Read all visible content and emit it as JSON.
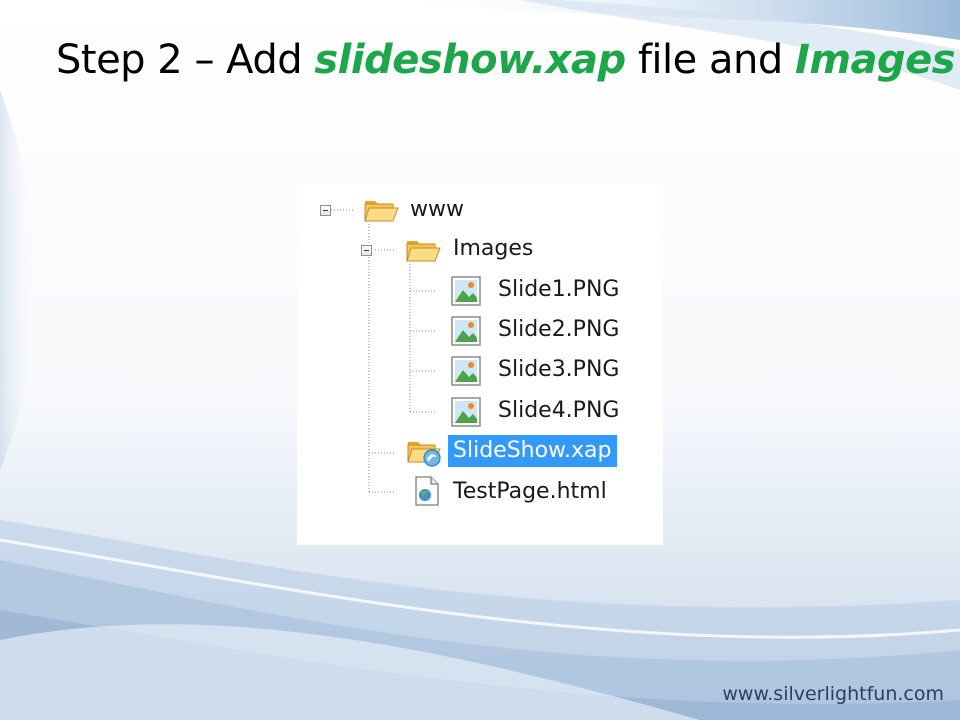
{
  "slide": {
    "title_part1": "Step 2 – Add ",
    "title_highlight1": "slideshow.xap",
    "title_part2": " file and ",
    "title_highlight2": "Images",
    "footer_url": "www.silverlightfun.com"
  },
  "tree": {
    "root": {
      "label": "www",
      "icon": "open-folder-icon",
      "expanded": true
    },
    "images_folder": {
      "label": "Images",
      "icon": "open-folder-icon",
      "expanded": true
    },
    "files": [
      {
        "label": "Slide1.PNG",
        "icon": "image-file-icon"
      },
      {
        "label": "Slide2.PNG",
        "icon": "image-file-icon"
      },
      {
        "label": "Slide3.PNG",
        "icon": "image-file-icon"
      },
      {
        "label": "Slide4.PNG",
        "icon": "image-file-icon"
      }
    ],
    "xap": {
      "label": "SlideShow.xap",
      "icon": "silverlight-package-icon",
      "selected": true
    },
    "html": {
      "label": "TestPage.html",
      "icon": "html-page-icon"
    }
  },
  "colors": {
    "title_highlight": "#1ea64a",
    "selection": "#3399ff",
    "folder": "#f2c04a"
  }
}
